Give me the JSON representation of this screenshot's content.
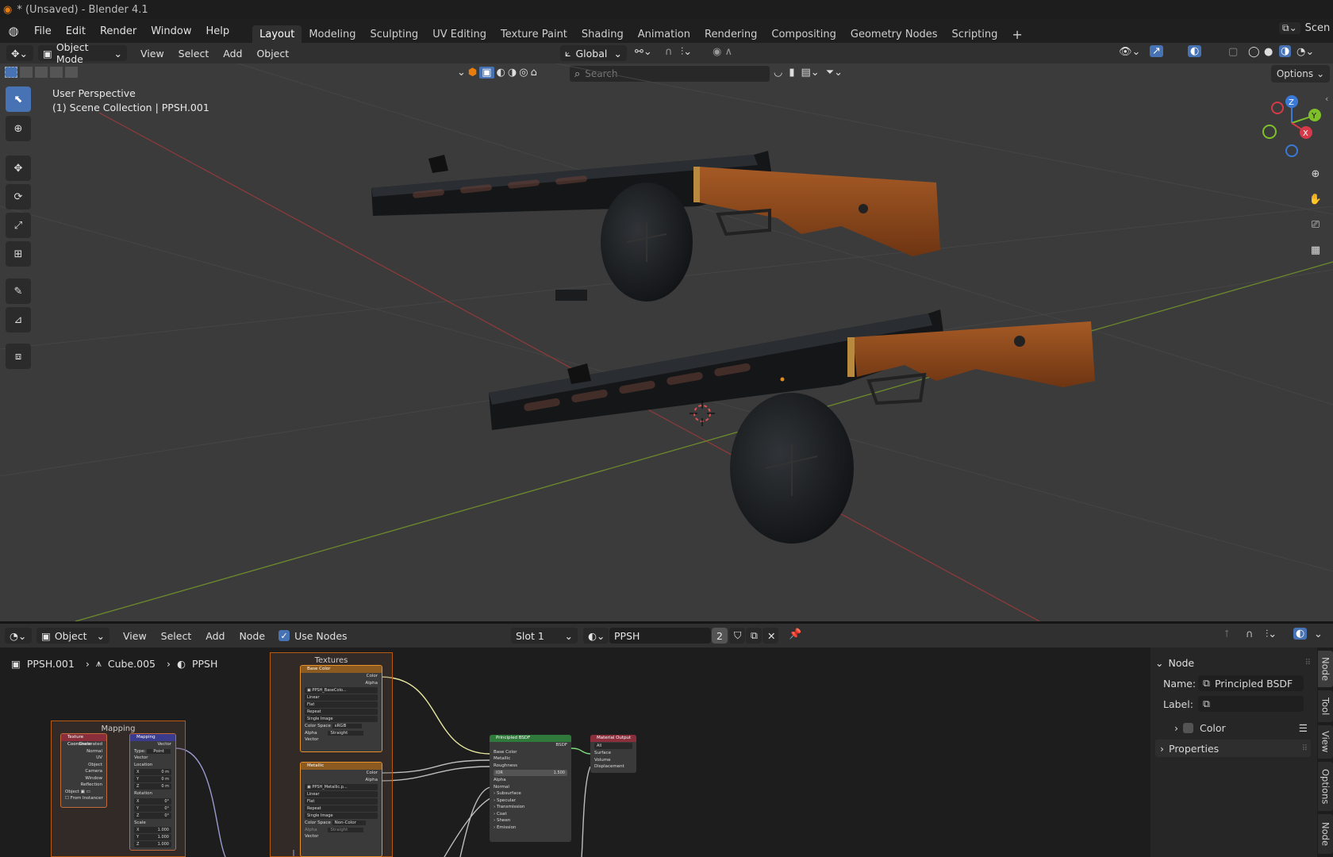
{
  "window": {
    "title": "* (Unsaved) - Blender 4.1"
  },
  "menus": [
    "File",
    "Edit",
    "Render",
    "Window",
    "Help"
  ],
  "workspaces": [
    "Layout",
    "Modeling",
    "Sculpting",
    "UV Editing",
    "Texture Paint",
    "Shading",
    "Animation",
    "Rendering",
    "Compositing",
    "Geometry Nodes",
    "Scripting"
  ],
  "active_workspace": "Layout",
  "scene_label": "Scen",
  "header3d": {
    "mode": "Object Mode",
    "menus": [
      "View",
      "Select",
      "Add",
      "Object"
    ],
    "orientation": "Global"
  },
  "viewport": {
    "perspective": "User Perspective",
    "collection": "(1) Scene Collection | PPSH.001",
    "search_placeholder": "Search",
    "options": "Options"
  },
  "gizmo": {
    "z": "Z",
    "y": "Y",
    "x": "X"
  },
  "node_header": {
    "object": "Object",
    "menus": [
      "View",
      "Select",
      "Add",
      "Node"
    ],
    "use_nodes": "Use Nodes",
    "slot": "Slot 1",
    "material": "PPSH",
    "users": "2"
  },
  "breadcrumb": [
    "PPSH.001",
    "Cube.005",
    "PPSH"
  ],
  "frames": {
    "textures": "Textures",
    "mapping": "Mapping"
  },
  "nodes": {
    "texcoord": {
      "title": "Texture Coordinate",
      "outputs": [
        "Generated",
        "Normal",
        "UV",
        "Object",
        "Camera",
        "Window",
        "Reflection"
      ],
      "object": "Object",
      "from_instancer": "From Instancer"
    },
    "mapping": {
      "title": "Mapping",
      "out": "Vector",
      "type_label": "Type:",
      "type": "Point",
      "vector": "Vector",
      "location": "Location",
      "loc": [
        "0 m",
        "0 m",
        "0 m"
      ],
      "rotation": "Rotation",
      "rot": [
        "0°",
        "0°",
        "0°"
      ],
      "scale": "Scale",
      "scl": [
        "1.000",
        "1.000",
        "1.000"
      ],
      "axes": [
        "X",
        "Y",
        "Z"
      ]
    },
    "basecolor": {
      "title": "Base Color",
      "outs": [
        "Color",
        "Alpha"
      ],
      "image": "PPSH_BaseColo...",
      "opts": [
        "Linear",
        "Flat",
        "Repeat",
        "Single Image"
      ],
      "cs_label": "Color Space",
      "cs": "sRGB",
      "alpha_label": "Alpha",
      "alpha": "Straight",
      "vector": "Vector"
    },
    "metallic": {
      "title": "Metallic",
      "outs": [
        "Color",
        "Alpha"
      ],
      "image": "PPSH_Metallic.p...",
      "opts": [
        "Linear",
        "Flat",
        "Repeat",
        "Single Image"
      ],
      "cs_label": "Color Space",
      "cs": "Non-Color",
      "alpha_label": "Alpha",
      "alpha": "Straight",
      "vector": "Vector"
    },
    "bsdf": {
      "title": "Principled BSDF",
      "out": "BSDF",
      "inputs": [
        "Base Color",
        "Metallic",
        "Roughness"
      ],
      "ior_label": "IOR",
      "ior": "1.500",
      "inputs2": [
        "Alpha",
        "Normal"
      ],
      "panels": [
        "Subsurface",
        "Specular",
        "Transmission",
        "Coat",
        "Sheen",
        "Emission"
      ]
    },
    "output": {
      "title": "Material Output",
      "target": "All",
      "inputs": [
        "Surface",
        "Volume",
        "Displacement"
      ]
    }
  },
  "npanel": {
    "node_header": "Node",
    "name_label": "Name:",
    "name": "Principled BSDF",
    "label_label": "Label:",
    "label": "",
    "color": "Color",
    "properties": "Properties",
    "tabs": [
      "Node",
      "Tool",
      "View",
      "Options",
      "Node"
    ]
  }
}
